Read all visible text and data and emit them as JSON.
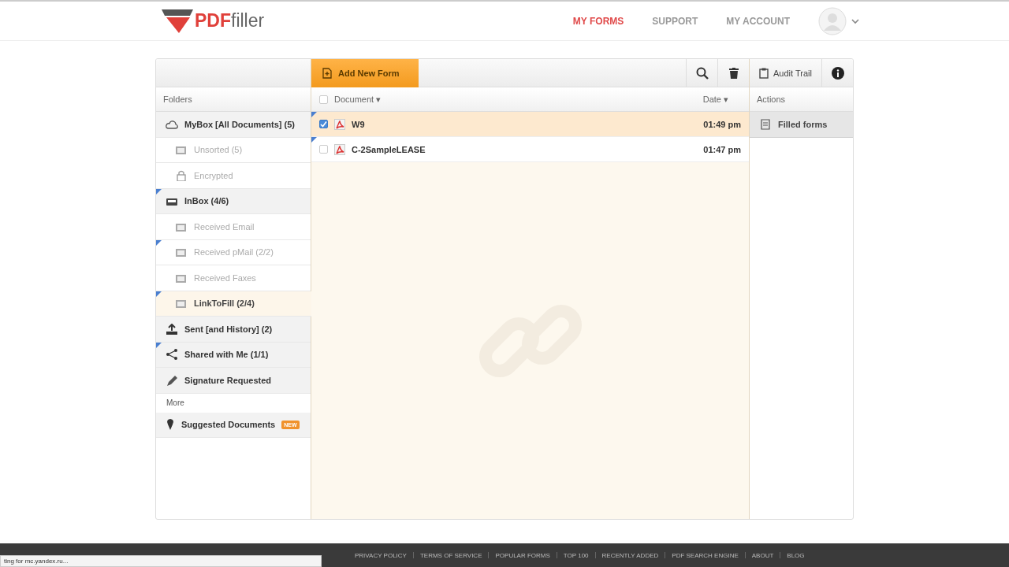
{
  "header": {
    "logo": {
      "prefix": "PDF",
      "suffix": "filler"
    },
    "nav": [
      {
        "label": "MY FORMS",
        "selected": true
      },
      {
        "label": "SUPPORT",
        "selected": false
      },
      {
        "label": "MY ACCOUNT",
        "selected": false
      }
    ]
  },
  "toolbar": {
    "add_button": "Add New Form",
    "audit_button": "Audit Trail"
  },
  "folders": {
    "heading": "Folders",
    "items": [
      {
        "label": "MyBox [All Documents] (5)",
        "kind": "group",
        "flag": false,
        "selected": false
      },
      {
        "label": "Unsorted  (5)",
        "kind": "sub",
        "flag": false,
        "selected": false
      },
      {
        "label": "Encrypted",
        "kind": "sub",
        "flag": false,
        "selected": false
      },
      {
        "label": "InBox (4/6)",
        "kind": "group",
        "flag": true,
        "selected": false
      },
      {
        "label": "Received Email",
        "kind": "sub",
        "flag": false,
        "selected": false
      },
      {
        "label": "Received pMail (2/2)",
        "kind": "sub",
        "flag": true,
        "selected": false
      },
      {
        "label": "Received Faxes",
        "kind": "sub",
        "flag": false,
        "selected": false
      },
      {
        "label": "LinkToFill (2/4)",
        "kind": "sub",
        "flag": true,
        "selected": true
      },
      {
        "label": "Sent [and History] (2)",
        "kind": "group",
        "flag": false,
        "selected": false
      },
      {
        "label": "Shared with Me (1/1)",
        "kind": "group",
        "flag": true,
        "selected": false
      },
      {
        "label": "Signature Requested",
        "kind": "group",
        "flag": false,
        "selected": false
      }
    ],
    "more_heading": "More",
    "suggested": {
      "label": "Suggested Documents",
      "badge": "NEW"
    }
  },
  "documents": {
    "all_checked": false,
    "columns": [
      "Document ▾",
      "Date ▾"
    ],
    "rows": [
      {
        "name": "W9",
        "date": "01:49 pm",
        "checked": true,
        "selected": true,
        "flag": true
      },
      {
        "name": "C-2SampleLEASE",
        "date": "01:47 pm",
        "checked": false,
        "selected": false,
        "flag": true
      }
    ]
  },
  "actions": {
    "heading": "Actions",
    "items": [
      "Filled forms"
    ]
  },
  "footer": {
    "links": [
      "PRIVACY POLICY",
      "TERMS OF SERVICE",
      "POPULAR FORMS",
      "TOP 100",
      "RECENTLY ADDED",
      "PDF SEARCH ENGINE",
      "ABOUT",
      "BLOG"
    ]
  },
  "status_bar": "ting for mc.yandex.ru..."
}
